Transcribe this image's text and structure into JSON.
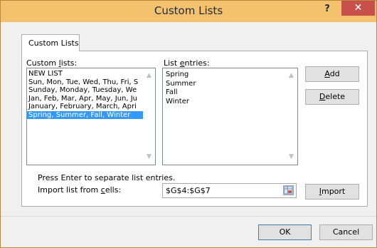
{
  "window": {
    "title": "Custom Lists",
    "help_label": "?",
    "close_label": "✕"
  },
  "tab": {
    "label": "Custom Lists"
  },
  "custom_lists": {
    "label_prefix": "Custom ",
    "label_accel": "l",
    "label_suffix": "ists:",
    "items": [
      "NEW LIST",
      "Sun, Mon, Tue, Wed, Thu, Fri, S",
      "Sunday, Monday, Tuesday, We",
      "Jan, Feb, Mar, Apr, May, Jun, Ju",
      "January, February, March, Apri",
      "Spring, Summer, Fall, Winter"
    ],
    "selected_index": 5
  },
  "list_entries": {
    "label_prefix": "List ",
    "label_accel": "e",
    "label_suffix": "ntries:",
    "items": [
      "Spring",
      "Summer",
      "Fall",
      "Winter"
    ]
  },
  "buttons": {
    "add_accel": "A",
    "add_rest": "dd",
    "delete_accel": "D",
    "delete_rest": "elete",
    "import_accel": "I",
    "import_rest": "mport",
    "ok": "OK",
    "cancel": "Cancel"
  },
  "hint": {
    "text": "Press Enter to separate list entries."
  },
  "import_from": {
    "label_prefix": "Import list from ",
    "label_accel": "c",
    "label_suffix": "ells:",
    "value": "$G$4:$G$7"
  },
  "icons": {
    "scroll_up": "scroll-up-arrow",
    "scroll_down": "scroll-down-arrow",
    "collapse": "range-collapse-icon"
  }
}
